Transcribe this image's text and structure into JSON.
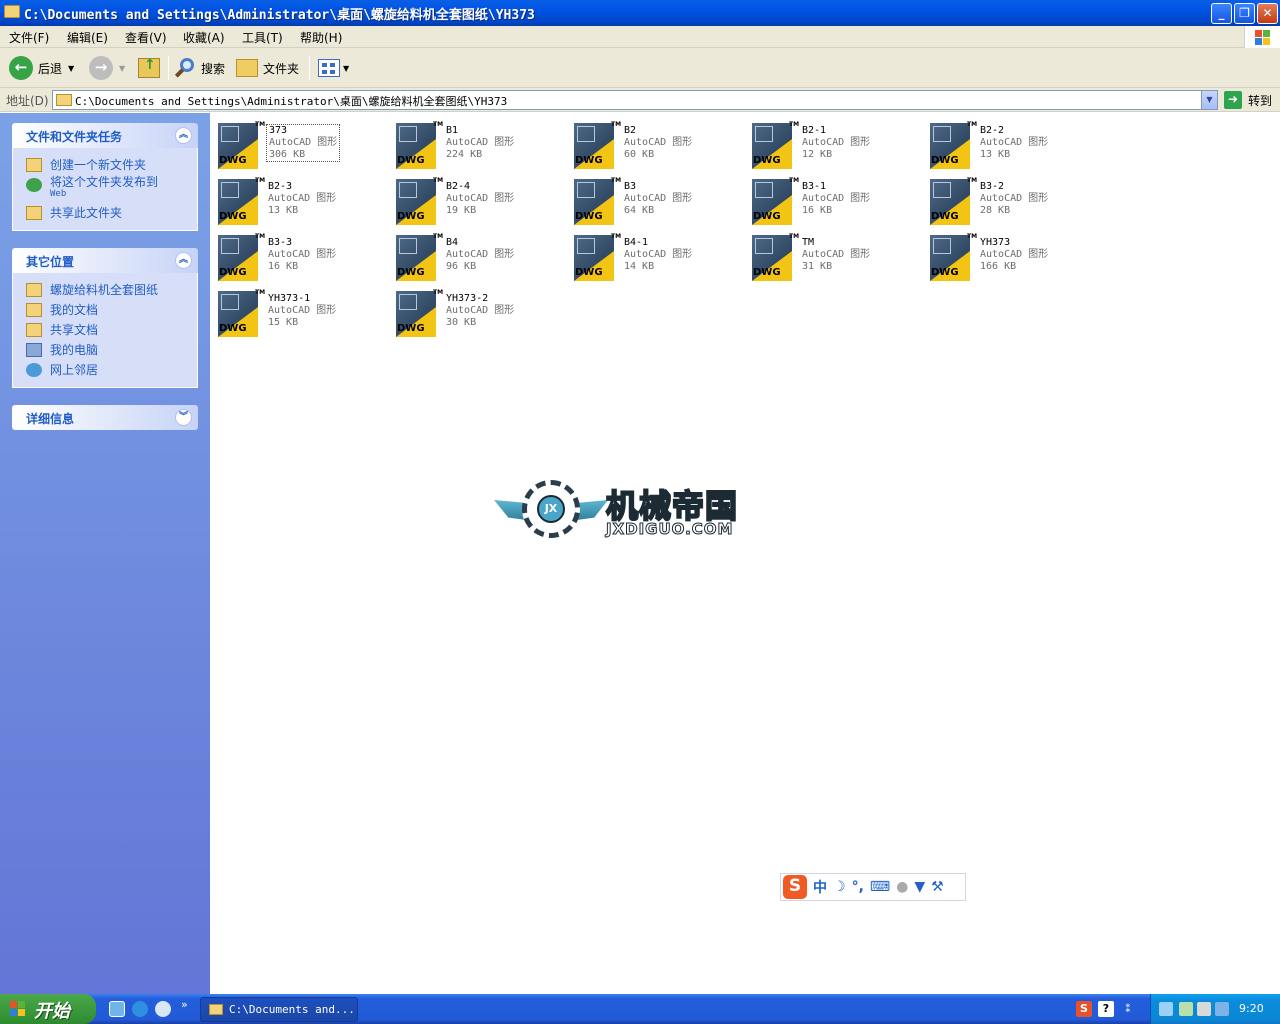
{
  "window": {
    "title": "C:\\Documents and Settings\\Administrator\\桌面\\螺旋给料机全套图纸\\YH373",
    "minimize": "_",
    "maximize": "❐",
    "close": "✕"
  },
  "menu": {
    "items": [
      "文件(F)",
      "编辑(E)",
      "查看(V)",
      "收藏(A)",
      "工具(T)",
      "帮助(H)"
    ]
  },
  "toolbar": {
    "back": "后退",
    "search": "搜索",
    "folders": "文件夹"
  },
  "address": {
    "label": "地址(D)",
    "value": "C:\\Documents and Settings\\Administrator\\桌面\\螺旋给料机全套图纸\\YH373",
    "go": "转到"
  },
  "left_pane": {
    "file_tasks": {
      "title": "文件和文件夹任务",
      "items": [
        "创建一个新文件夹",
        "将这个文件夹发布到",
        "共享此文件夹"
      ],
      "publish_sub": "Web"
    },
    "other_places": {
      "title": "其它位置",
      "items": [
        "螺旋给料机全套图纸",
        "我的文档",
        "共享文档",
        "我的电脑",
        "网上邻居"
      ]
    },
    "details": {
      "title": "详细信息"
    }
  },
  "files": [
    {
      "name": "373",
      "type": "AutoCAD 图形",
      "size": "306 KB",
      "selected": true
    },
    {
      "name": "B1",
      "type": "AutoCAD 图形",
      "size": "224 KB"
    },
    {
      "name": "B2",
      "type": "AutoCAD 图形",
      "size": "60 KB"
    },
    {
      "name": "B2-1",
      "type": "AutoCAD 图形",
      "size": "12 KB"
    },
    {
      "name": "B2-2",
      "type": "AutoCAD 图形",
      "size": "13 KB"
    },
    {
      "name": "B2-3",
      "type": "AutoCAD 图形",
      "size": "13 KB"
    },
    {
      "name": "B2-4",
      "type": "AutoCAD 图形",
      "size": "19 KB"
    },
    {
      "name": "B3",
      "type": "AutoCAD 图形",
      "size": "64 KB"
    },
    {
      "name": "B3-1",
      "type": "AutoCAD 图形",
      "size": "16 KB"
    },
    {
      "name": "B3-2",
      "type": "AutoCAD 图形",
      "size": "28 KB"
    },
    {
      "name": "B3-3",
      "type": "AutoCAD 图形",
      "size": "16 KB"
    },
    {
      "name": "B4",
      "type": "AutoCAD 图形",
      "size": "96 KB"
    },
    {
      "name": "B4-1",
      "type": "AutoCAD 图形",
      "size": "14 KB"
    },
    {
      "name": "TM",
      "type": "AutoCAD 图形",
      "size": "31 KB"
    },
    {
      "name": "YH373",
      "type": "AutoCAD 图形",
      "size": "166 KB"
    },
    {
      "name": "YH373-1",
      "type": "AutoCAD 图形",
      "size": "15 KB"
    },
    {
      "name": "YH373-2",
      "type": "AutoCAD 图形",
      "size": "30 KB"
    }
  ],
  "file_icon": {
    "label": "DWG",
    "tm": "TM"
  },
  "watermark": {
    "initials": "JX",
    "cn": "机械帝国",
    "en": "JXDIGUO.COM"
  },
  "ime": {
    "logo": "S",
    "mode": "中"
  },
  "taskbar": {
    "start": "开始",
    "window_button": "C:\\Documents and...",
    "more": "»",
    "clock": "9:20"
  },
  "colors": {
    "xp_blue": "#0053e3",
    "pane_top": "#7ba2e7",
    "pane_bottom": "#6375d6",
    "link": "#215dc6",
    "start_green": "#3c9a3d"
  }
}
